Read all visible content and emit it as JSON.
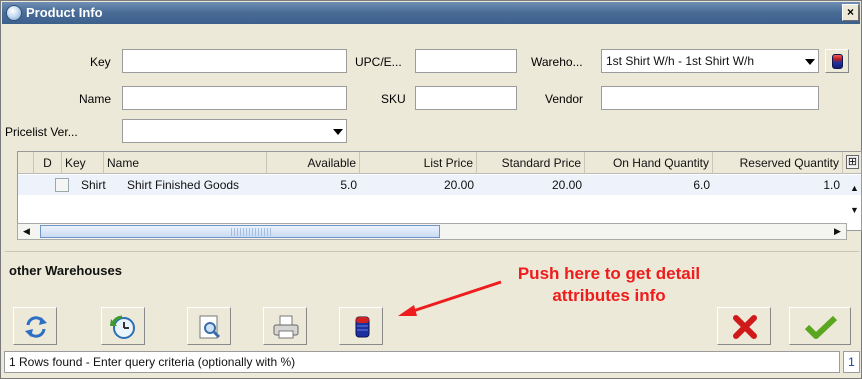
{
  "window": {
    "title": "Product Info",
    "close_glyph": "×"
  },
  "query": {
    "key_label": "Key",
    "key_value": "",
    "upc_label": "UPC/E...",
    "upc_value": "",
    "warehouse_label": "Wareho...",
    "warehouse_value": "1st Shirt W/h - 1st Shirt W/h",
    "name_label": "Name",
    "name_value": "",
    "sku_label": "SKU",
    "sku_value": "",
    "vendor_label": "Vendor",
    "vendor_value": "",
    "pricelist_label": "Pricelist Ver...",
    "pricelist_value": ""
  },
  "table": {
    "columns": [
      "D",
      "Key",
      "Name",
      "Available",
      "List Price",
      "Standard Price",
      "On Hand Quantity",
      "Reserved Quantity"
    ],
    "rows": [
      {
        "d": "",
        "key": "Shirt",
        "name": "Shirt Finished Goods",
        "available": "5.0",
        "list_price": "20.00",
        "standard_price": "20.00",
        "on_hand": "6.0",
        "reserved": "1.0"
      }
    ],
    "corner_glyph": "⊞",
    "scroll_up_glyph": "▲",
    "scroll_down_glyph": "▼",
    "scroll_left_glyph": "◀",
    "scroll_right_glyph": "▶"
  },
  "section": {
    "title": "other Warehouses"
  },
  "annotation": {
    "line1": "Push here to get detail",
    "line2": "attributes info",
    "color": "#ee1c1c"
  },
  "toolbar": {
    "icons": [
      "refresh-icon",
      "history-icon",
      "zoom-icon",
      "print-icon",
      "attribute-info-icon",
      "cancel-icon",
      "ok-icon"
    ]
  },
  "status": {
    "message": "1 Rows found - Enter query criteria (optionally with %)",
    "count": "1"
  }
}
